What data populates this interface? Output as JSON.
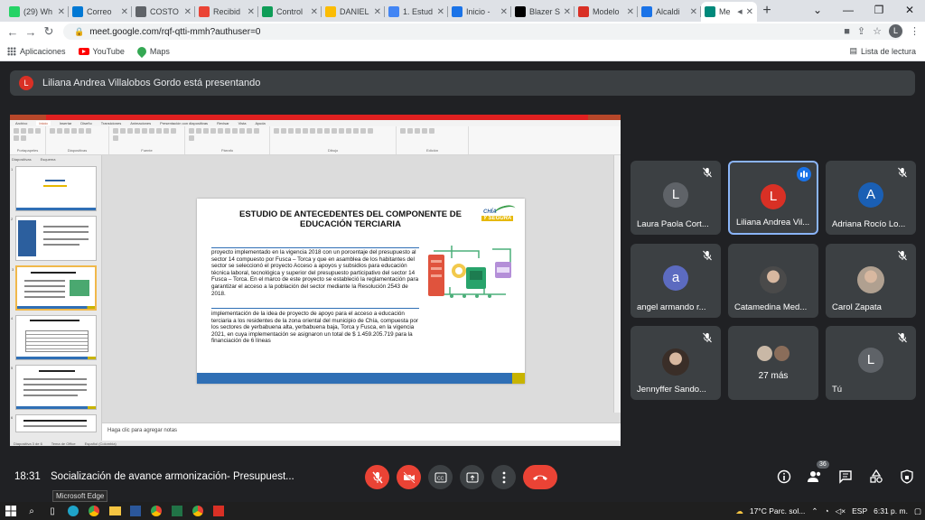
{
  "browser": {
    "tabs": [
      {
        "label": "(29) Wh",
        "color": "#25d366"
      },
      {
        "label": "Correo",
        "color": "#0078d4"
      },
      {
        "label": "COSTO",
        "color": "#5f6368"
      },
      {
        "label": "Recibid",
        "color": "#ea4335"
      },
      {
        "label": "Control",
        "color": "#0f9d58"
      },
      {
        "label": "DANIEL",
        "color": "#fbbc04"
      },
      {
        "label": "1. Estud",
        "color": "#4285f4"
      },
      {
        "label": "Inicio -",
        "color": "#1a73e8"
      },
      {
        "label": "Blazer S",
        "color": "#000000"
      },
      {
        "label": "Modelo",
        "color": "#d93025"
      },
      {
        "label": "Alcaldi",
        "color": "#1a73e8"
      },
      {
        "label": "Me",
        "color": "#00897b"
      }
    ],
    "url": "meet.google.com/rqf-qtti-mmh?authuser=0",
    "profile_initial": "L",
    "bookmarks": [
      "Aplicaciones",
      "YouTube",
      "Maps"
    ],
    "reading_list": "Lista de lectura"
  },
  "meet": {
    "presenter_initial": "L",
    "presenter_banner": "Liliana Andrea Villalobos Gordo está presentando",
    "time": "18:31",
    "meeting_title": "Socialización de avance armonización- Presupuest...",
    "participants_count": "36",
    "participants": [
      {
        "name": "Laura Paola Cort...",
        "initial": "L",
        "color": "#5f6368"
      },
      {
        "name": "Liliana Andrea Vil...",
        "initial": "L",
        "color": "#d93025"
      },
      {
        "name": "Adriana Rocío Lo...",
        "initial": "A",
        "color": "#1a5fb4"
      },
      {
        "name": "angel armando r...",
        "initial": "a",
        "color": "#5c6bc0"
      },
      {
        "name": "Catamedina Med...",
        "initial": "",
        "color": "#4a4a4a"
      },
      {
        "name": "Carol Zapata",
        "initial": "",
        "color": "#b0a090"
      },
      {
        "name": "Jennyffer Sando...",
        "initial": "",
        "color": "#3a2e28"
      },
      {
        "name": "",
        "initial": "",
        "color": "#888888"
      },
      {
        "name": "Tú",
        "initial": "L",
        "color": "#5f6368"
      }
    ],
    "more_label": "27 más"
  },
  "presentation": {
    "menu": [
      "Archivo",
      "Inicio",
      "Insertar",
      "Diseño",
      "Transiciones",
      "Animaciones",
      "Presentación con diapositivas",
      "Revisar",
      "Vista",
      "Ayuda"
    ],
    "thumb_tabs": [
      "Diapositivas",
      "Esquema"
    ],
    "notes_placeholder": "Haga clic para agregar notas",
    "status": [
      "Diapositiva 3 de 6",
      "Tema de Office",
      "Español (Colombia)"
    ],
    "slide": {
      "title": "ESTUDIO DE ANTECEDENTES DEL COMPONENTE DE EDUCACIÓN TERCIARIA",
      "logo_line1": "CHÍA",
      "logo_line2": "Y SEGURA",
      "para1": "proyecto implementado  en la vigencia 2018 con un porcentaje del presupuesto  al sector 14 compuesto  por Fusca – Torca y que en asamblea de los habitantes del sector se seleccionó el proyecto Acceso a apoyos y subsidios para educación técnica laboral, tecnológica y superior del presupuesto participativo del sector 14 Fusca – Torca. En el marco de este proyecto se estableció la reglamentación para garantizar el acceso a la población del sector mediante la Resolución 2543 de 2018.",
      "para2": "implementación  de la idea de proyecto de apoyo para el acceso a educación terciaria a los residentes de la zona oriental del municipio de Chía, compuesta por los sectores de yerbabuena alta, yerbabuena baja, Torca y Fusca, en la vigencia 2021, en cuya implementación  se asignaron un total de $ 1.459.205.719 para la financiación de 6 líneas"
    }
  },
  "taskbar": {
    "tooltip": "Microsoft Edge",
    "weather": "17°C  Parc. sol...",
    "language": "ESP",
    "clock": "6:31 p. m."
  }
}
